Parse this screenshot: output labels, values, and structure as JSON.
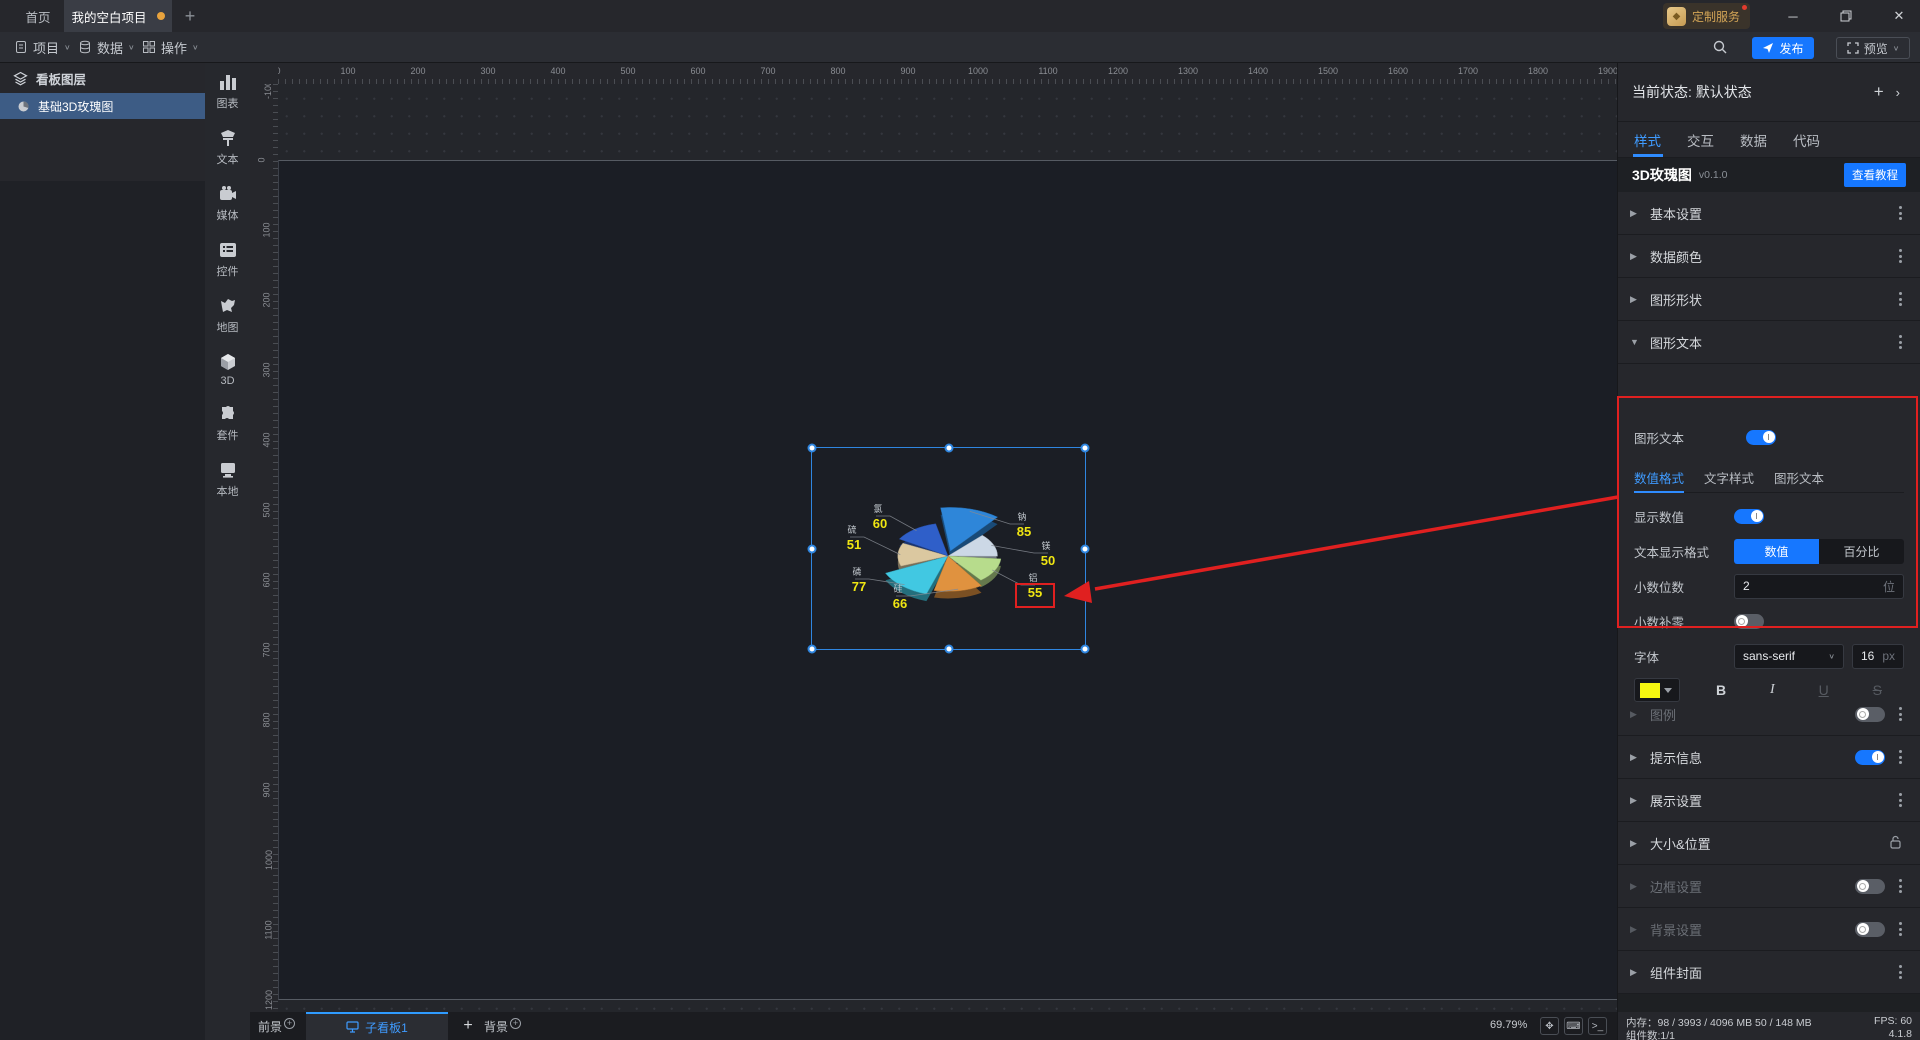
{
  "window": {
    "tabs": [
      {
        "label": "首页",
        "active": false
      },
      {
        "label": "我的空白项目",
        "active": true,
        "modified": true
      }
    ],
    "badge": "定制服务"
  },
  "menubar": {
    "items": [
      {
        "label": "项目"
      },
      {
        "label": "数据"
      },
      {
        "label": "操作"
      }
    ],
    "publish_label": "发布",
    "preview_label": "预览"
  },
  "layers_panel": {
    "title": "看板图层",
    "items": [
      {
        "label": "基础3D玫瑰图",
        "selected": true
      }
    ]
  },
  "component_toolbar": [
    {
      "id": "chart",
      "label": "图表"
    },
    {
      "id": "text",
      "label": "文本"
    },
    {
      "id": "media",
      "label": "媒体"
    },
    {
      "id": "widget",
      "label": "控件"
    },
    {
      "id": "map",
      "label": "地图"
    },
    {
      "id": "three-d",
      "label": "3D"
    },
    {
      "id": "kit",
      "label": "套件"
    },
    {
      "id": "local",
      "label": "本地"
    }
  ],
  "canvas": {
    "zoom_percent": "69.79%",
    "scale": 0.7,
    "h_ruler": {
      "start": 0,
      "end": 1900,
      "step": 100
    },
    "v_ruler": {
      "start": -100,
      "end": 1200,
      "step": 100
    }
  },
  "chart_data": {
    "type": "pie",
    "subtype": "3d-rose",
    "title": "基础3D玫瑰图",
    "categories": [
      "钠",
      "镁",
      "铝",
      "硅",
      "磷",
      "硫",
      "氯"
    ],
    "values": [
      85,
      50,
      55,
      66,
      77,
      51,
      60
    ],
    "colors": [
      "#2e86d9",
      "#ccd8e6",
      "#b7dc8c",
      "#e0923f",
      "#41c8e2",
      "#dbc8a0",
      "#2f5fc9"
    ],
    "value_label_color": "#f0e612",
    "name_label_color": "#c3c9cf",
    "exploded_category": "钠",
    "boxed_value_category": "铝",
    "legend_position": "none",
    "label_positions": [
      [
        224,
        78
      ],
      [
        248,
        107
      ],
      [
        235,
        139
      ],
      [
        100,
        150
      ],
      [
        59,
        133
      ],
      [
        54,
        91
      ],
      [
        80,
        70
      ]
    ]
  },
  "inspector": {
    "state_label": "当前状态:",
    "state_value": "默认状态",
    "tabs": [
      {
        "label": "样式",
        "active": true
      },
      {
        "label": "交互"
      },
      {
        "label": "数据"
      },
      {
        "label": "代码"
      }
    ],
    "component_name": "3D玫瑰图",
    "component_version": "v0.1.0",
    "tutorial_label": "查看教程",
    "sections_top": [
      {
        "label": "基本设置",
        "trailing": "menu"
      },
      {
        "label": "数据颜色",
        "trailing": "menu"
      },
      {
        "label": "图形形状",
        "trailing": "menu"
      },
      {
        "label": "图形文本",
        "trailing": "menu",
        "expanded": true
      }
    ],
    "graphic_text_toggle_label": "图形文本",
    "format_box": {
      "sub_tabs": [
        {
          "label": "数值格式",
          "active": true
        },
        {
          "label": "文字样式"
        },
        {
          "label": "图形文本"
        }
      ],
      "show_value_label": "显示数值",
      "show_value_on": true,
      "display_format_label": "文本显示格式",
      "display_format_options": [
        {
          "label": "数值",
          "active": true
        },
        {
          "label": "百分比"
        }
      ],
      "decimals_label": "小数位数",
      "decimals_value": "2",
      "decimals_unit": "位",
      "pad_zero_label": "小数补零",
      "pad_zero_on": false,
      "font_label": "字体",
      "font_value": "sans-serif",
      "font_size_value": "16",
      "font_size_unit": "px",
      "font_color": "#f7f711",
      "style_buttons": {
        "bold": "B",
        "italic": "I",
        "underline": "U",
        "strike": "S"
      }
    },
    "sections_bottom": [
      {
        "label": "图例",
        "disabled": true,
        "toggle": "off",
        "trailing": "menu"
      },
      {
        "label": "提示信息",
        "toggle": "on",
        "trailing": "menu"
      },
      {
        "label": "展示设置",
        "trailing": "menu"
      },
      {
        "label": "大小&位置",
        "trailing": "lock"
      },
      {
        "label": "边框设置",
        "disabled": true,
        "toggle": "off",
        "trailing": "menu"
      },
      {
        "label": "背景设置",
        "disabled": true,
        "toggle": "off",
        "trailing": "menu"
      },
      {
        "label": "组件封面",
        "trailing": "menu"
      }
    ]
  },
  "bottom_bar": {
    "foreground_label": "前景",
    "subboard_tab": "子看板1",
    "background_label": "背景"
  },
  "status_footer": {
    "memory_label": "内存：",
    "memory_value": "98 / 3993 / 4096 MB  50 / 148 MB",
    "fps_label": "FPS:",
    "fps_value": "60",
    "components_label": "组件数:",
    "components_value": "1/1",
    "version": "4.1.8"
  },
  "annotation_color": "#e02020",
  "accent_color": "#1677ff"
}
